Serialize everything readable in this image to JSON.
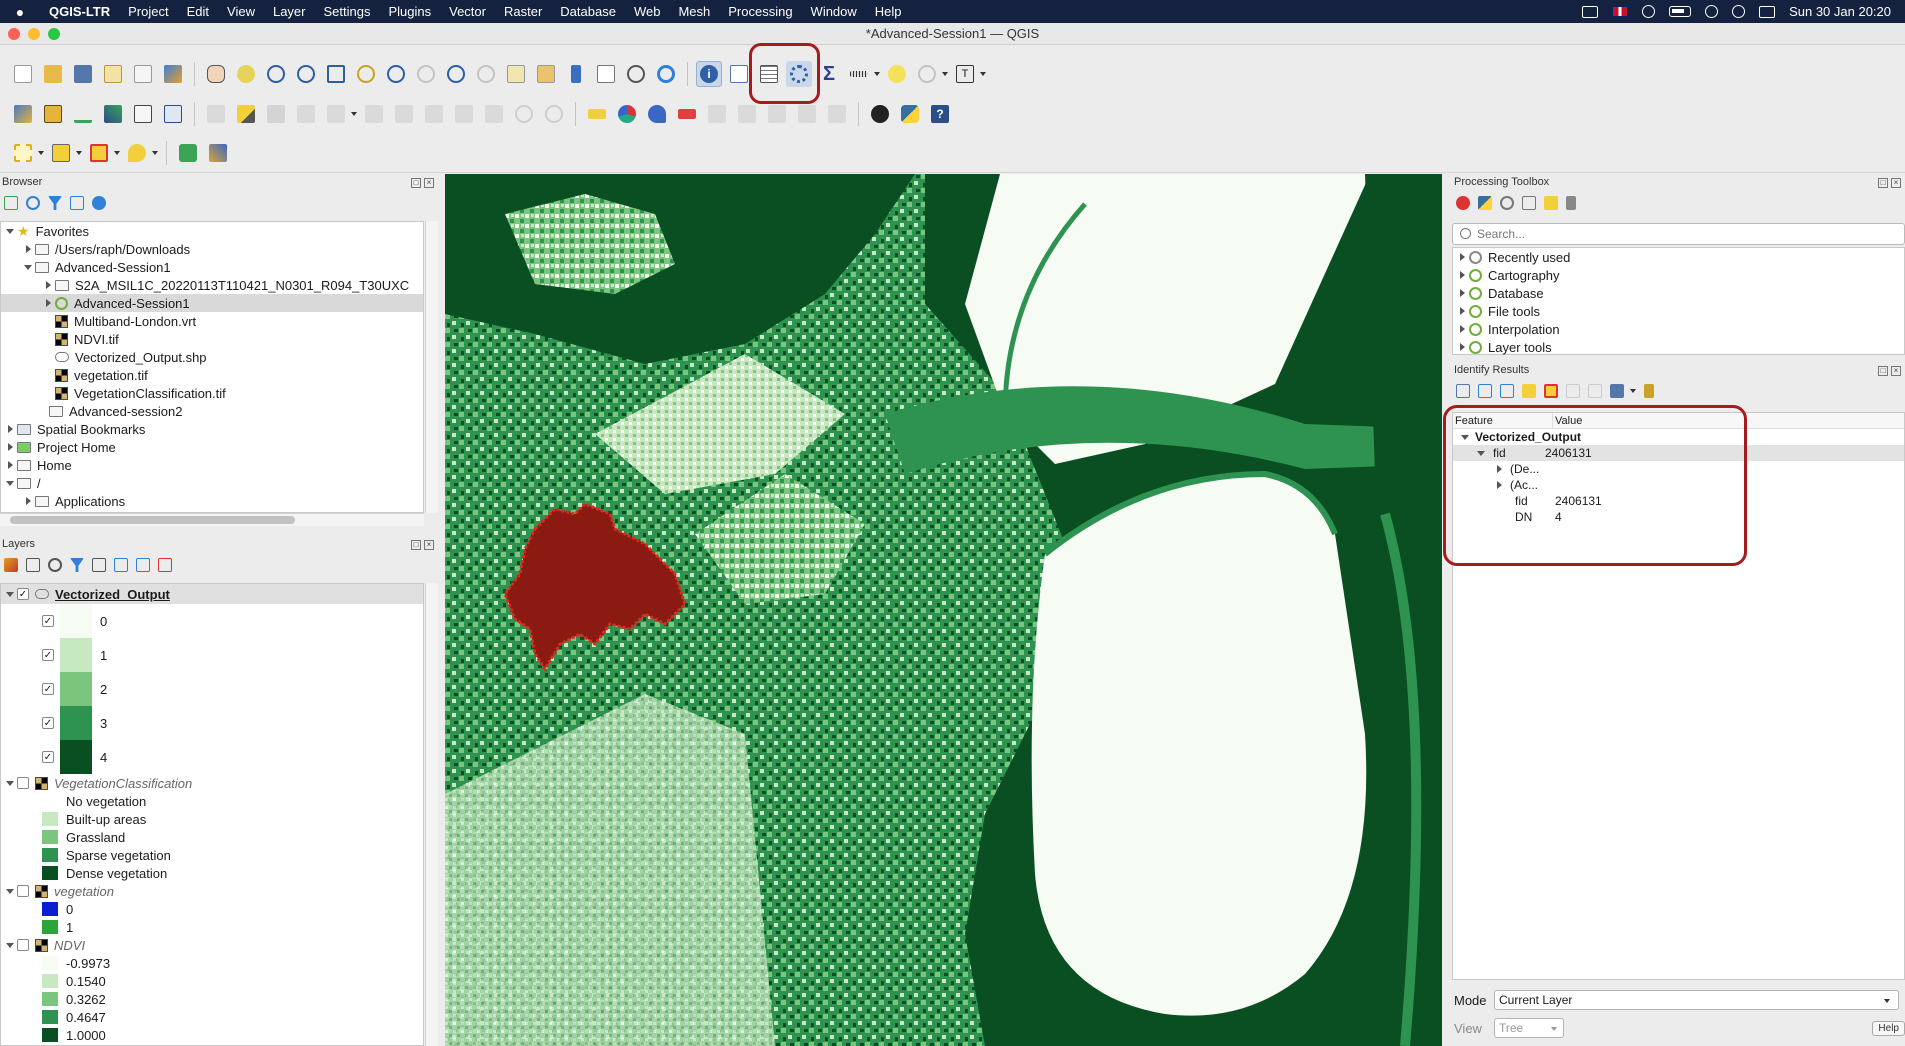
{
  "menubar": {
    "app_name": "QGIS-LTR",
    "items": [
      "Project",
      "Edit",
      "View",
      "Layer",
      "Settings",
      "Plugins",
      "Vector",
      "Raster",
      "Database",
      "Web",
      "Mesh",
      "Processing",
      "Window",
      "Help"
    ],
    "clock": "Sun 30 Jan  20:20"
  },
  "window": {
    "title": "*Advanced-Session1 — QGIS"
  },
  "browser": {
    "title": "Browser",
    "items": [
      {
        "label": "Favorites",
        "icon": "star-icon"
      },
      {
        "label": "/Users/raph/Downloads",
        "icon": "folder-icon"
      },
      {
        "label": "Advanced-Session1",
        "icon": "folder-icon"
      },
      {
        "label": "S2A_MSIL1C_20220113T110421_N0301_R094_T30UXC",
        "icon": "folder-icon"
      },
      {
        "label": "Advanced-Session1",
        "icon": "qgis-project-icon"
      },
      {
        "label": "Multiband-London.vrt",
        "icon": "raster-icon"
      },
      {
        "label": "NDVI.tif",
        "icon": "raster-icon"
      },
      {
        "label": "Vectorized_Output.shp",
        "icon": "vector-icon"
      },
      {
        "label": "vegetation.tif",
        "icon": "raster-icon"
      },
      {
        "label": "VegetationClassification.tif",
        "icon": "raster-icon"
      },
      {
        "label": "Advanced-session2",
        "icon": "folder-icon"
      },
      {
        "label": "Spatial Bookmarks",
        "icon": "bookmark-icon"
      },
      {
        "label": "Project Home",
        "icon": "project-home-icon"
      },
      {
        "label": "Home",
        "icon": "home-icon"
      },
      {
        "label": "/",
        "icon": "folder-icon"
      },
      {
        "label": "Applications",
        "icon": "folder-icon"
      }
    ]
  },
  "layers": {
    "title": "Layers",
    "vectorized": {
      "name": "Vectorized_Output",
      "classes": [
        {
          "label": "0",
          "color": "#f6fbf4"
        },
        {
          "label": "1",
          "color": "#c8e8c2"
        },
        {
          "label": "2",
          "color": "#7cc57f"
        },
        {
          "label": "3",
          "color": "#2e9350"
        },
        {
          "label": "4",
          "color": "#0a4f22"
        }
      ]
    },
    "vegclass": {
      "name": "VegetationClassification",
      "classes": [
        {
          "label": "No vegetation",
          "color": "#ffffff"
        },
        {
          "label": "Built-up areas",
          "color": "#c8e8c2"
        },
        {
          "label": "Grassland",
          "color": "#7cc57f"
        },
        {
          "label": "Sparse vegetation",
          "color": "#2e9350"
        },
        {
          "label": "Dense vegetation",
          "color": "#0a4f22"
        }
      ]
    },
    "vegetation": {
      "name": "vegetation",
      "classes": [
        {
          "label": "0",
          "color": "#0a1fd0"
        },
        {
          "label": "1",
          "color": "#2ea33a"
        }
      ]
    },
    "ndvi": {
      "name": "NDVI",
      "classes": [
        {
          "label": "-0.9973",
          "color": "#f6fbf4"
        },
        {
          "label": "0.1540",
          "color": "#c8e8c2"
        },
        {
          "label": "0.3262",
          "color": "#7cc57f"
        },
        {
          "label": "0.4647",
          "color": "#2e9350"
        },
        {
          "label": "1.0000",
          "color": "#0a4f22"
        }
      ]
    }
  },
  "processing": {
    "title": "Processing Toolbox",
    "search_placeholder": "Search...",
    "groups": [
      "Recently used",
      "Cartography",
      "Database",
      "File tools",
      "Interpolation",
      "Layer tools"
    ]
  },
  "identify": {
    "title": "Identify Results",
    "col_feature": "Feature",
    "col_value": "Value",
    "layer": "Vectorized_Output",
    "fid_label": "fid",
    "fid_value": "2406131",
    "derived": "(De...",
    "actions": "(Ac...",
    "attr_fid_label": "fid",
    "attr_fid_value": "2406131",
    "attr_dn_label": "DN",
    "attr_dn_value": "4",
    "mode_label": "Mode",
    "mode_value": "Current Layer",
    "view_label": "View",
    "view_value": "Tree",
    "help": "Help"
  },
  "colors": {
    "highlight": "#a51c1c",
    "selected_feature": "#8b1a12",
    "dense": "#0a4f22",
    "sparse": "#2e9350",
    "grass": "#7cc57f",
    "built": "#c8e8c2",
    "none": "#f6fbf4"
  }
}
